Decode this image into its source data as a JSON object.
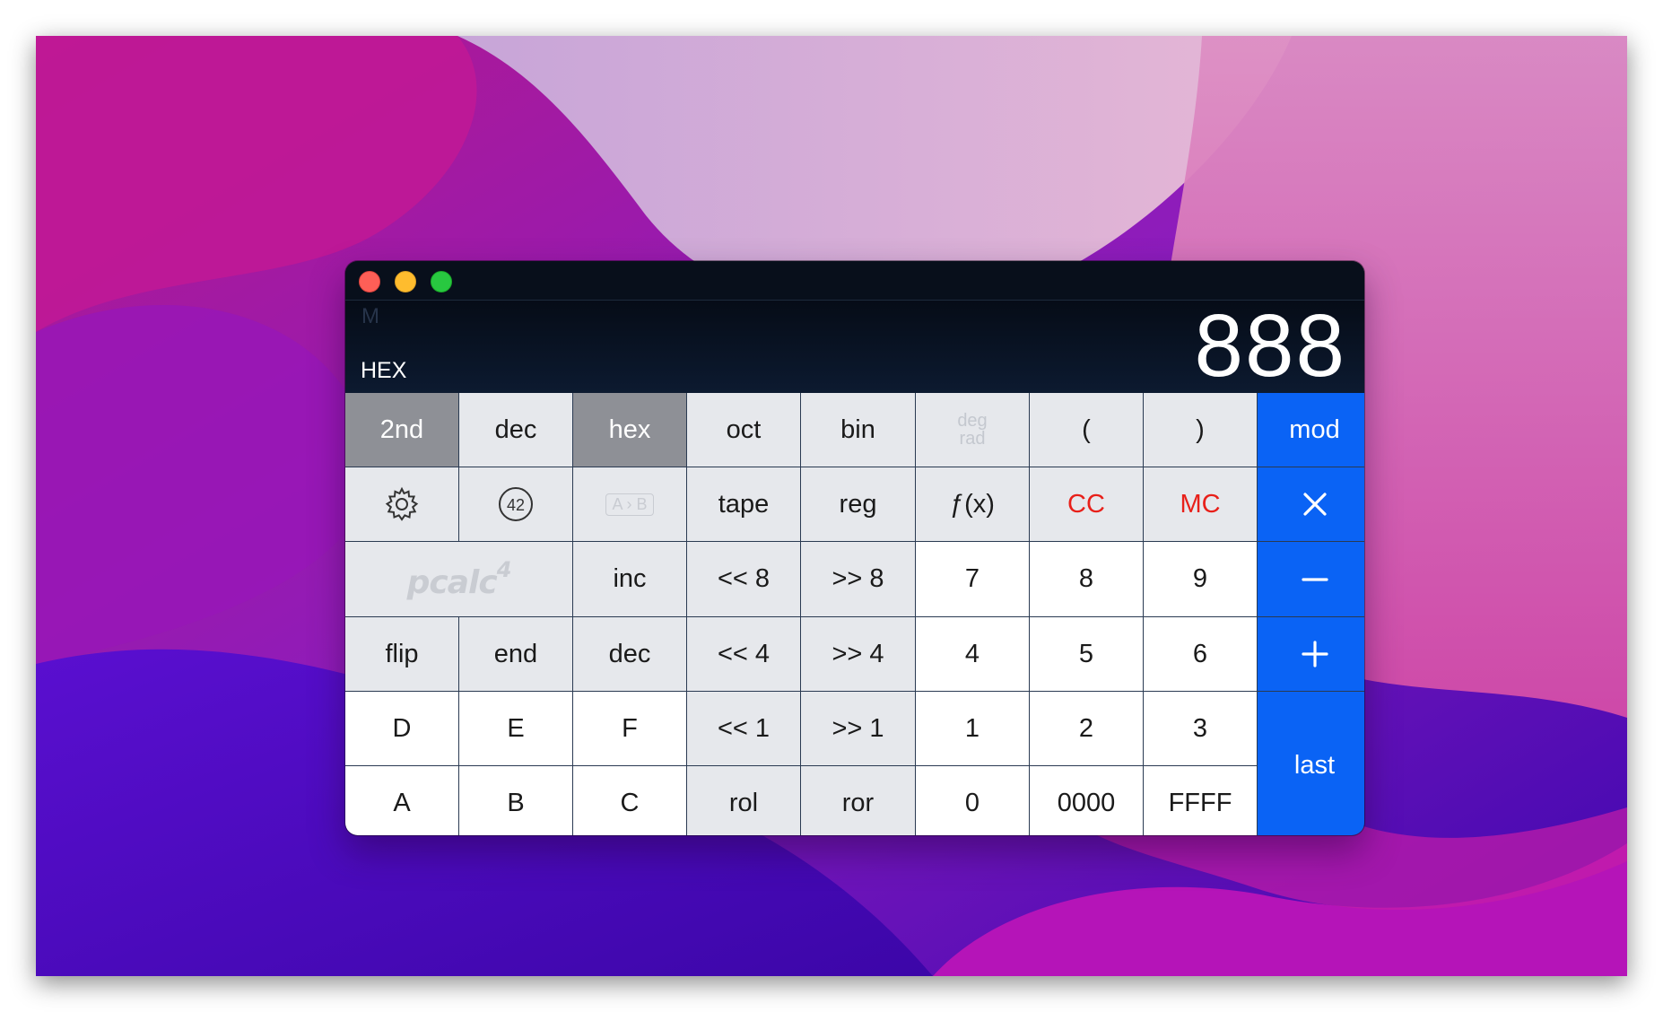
{
  "window": {
    "mode_label": "HEX",
    "memory_indicator": "M",
    "display_value": "888"
  },
  "keys": {
    "row1": [
      "2nd",
      "dec",
      "hex",
      "oct",
      "bin",
      "deg",
      "rad",
      "(",
      ")",
      "mod"
    ],
    "row2": [
      "settings",
      "42",
      "A › B",
      "tape",
      "reg",
      "ƒ(x)",
      "CC",
      "MC",
      "×"
    ],
    "row3": [
      "pcalc",
      "4",
      "inc",
      "<< 8",
      ">> 8",
      "7",
      "8",
      "9",
      "−"
    ],
    "row4": [
      "flip",
      "end",
      "dec",
      "<< 4",
      ">> 4",
      "4",
      "5",
      "6",
      "+"
    ],
    "row5": [
      "D",
      "E",
      "F",
      "<< 1",
      ">> 1",
      "1",
      "2",
      "3",
      "last"
    ],
    "row6": [
      "A",
      "B",
      "C",
      "rol",
      "ror",
      "0",
      "0000",
      "FFFF"
    ]
  },
  "colors": {
    "operator": "#0a63f5",
    "active_key": "#8e9096",
    "memory_red": "#e8201a",
    "display_bg": "#0b1626"
  },
  "icons": {
    "settings": "gear-icon",
    "const42": "circled-42-icon",
    "swap": "a-to-b-swap-icon"
  }
}
